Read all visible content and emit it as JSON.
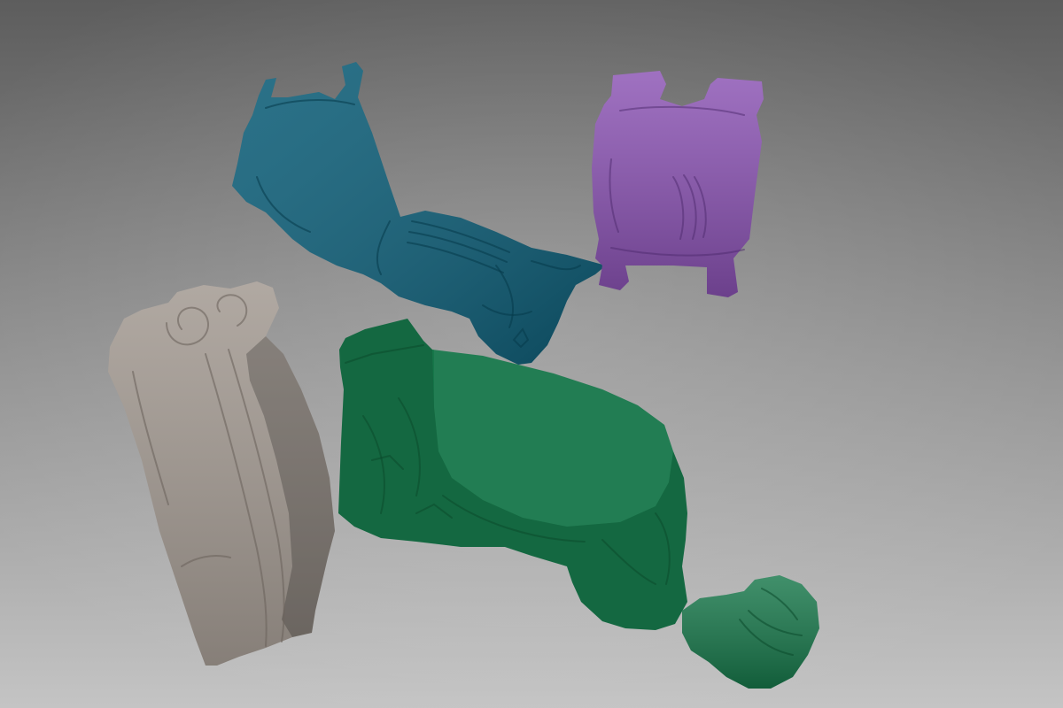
{
  "viewer": {
    "background": {
      "top_color": "#5d5d5d",
      "bottom_color": "#c4c4c4"
    },
    "fragments": [
      {
        "name": "horse-forequarter-fragment",
        "color": "#0d5e78"
      },
      {
        "name": "saddle-torso-fragment",
        "color": "#8a52b3"
      },
      {
        "name": "volute-stone-fragment",
        "color": "#a39a92"
      },
      {
        "name": "base-block-fragment",
        "color": "#17774a"
      },
      {
        "name": "small-hoof-fragment",
        "color": "#17774a"
      }
    ]
  }
}
